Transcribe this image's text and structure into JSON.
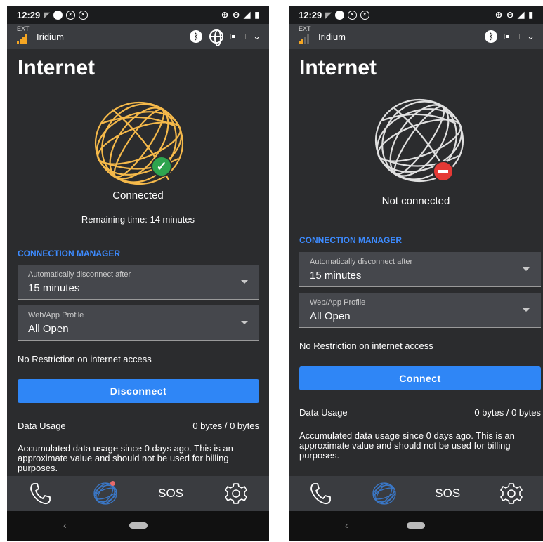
{
  "left": {
    "statusbar": {
      "time": "12:29"
    },
    "topbar": {
      "ext_label": "EXT",
      "network": "Iridium"
    },
    "page_title": "Internet",
    "status_text": "Connected",
    "remaining": "Remaining time: 14 minutes",
    "section_title": "CONNECTION MANAGER",
    "disconnect_dropdown": {
      "label": "Automatically disconnect after",
      "value": "15 minutes"
    },
    "profile_dropdown": {
      "label": "Web/App Profile",
      "value": "All Open"
    },
    "restriction_note": "No Restriction on internet access",
    "action_button": "Disconnect",
    "data_usage": {
      "label": "Data Usage",
      "value": "0 bytes / 0 bytes"
    },
    "usage_note": "Accumulated data usage since 0 days ago. This is an approximate value and should not be used for billing purposes.",
    "nav": {
      "sos": "SOS"
    }
  },
  "right": {
    "statusbar": {
      "time": "12:29"
    },
    "topbar": {
      "ext_label": "EXT",
      "network": "Iridium"
    },
    "page_title": "Internet",
    "status_text": "Not connected",
    "section_title": "CONNECTION MANAGER",
    "disconnect_dropdown": {
      "label": "Automatically disconnect after",
      "value": "15 minutes"
    },
    "profile_dropdown": {
      "label": "Web/App Profile",
      "value": "All Open"
    },
    "restriction_note": "No Restriction on internet access",
    "action_button": "Connect",
    "data_usage": {
      "label": "Data Usage",
      "value": "0 bytes / 0 bytes"
    },
    "usage_note": "Accumulated data usage since 0 days ago. This is an approximate value and should not be used for billing purposes.",
    "nav": {
      "sos": "SOS"
    }
  },
  "colors": {
    "globe_connected": "#f5b94a",
    "globe_disconnected": "#e0e0e0",
    "accent": "#2f86f6",
    "section": "#3d8bff"
  }
}
